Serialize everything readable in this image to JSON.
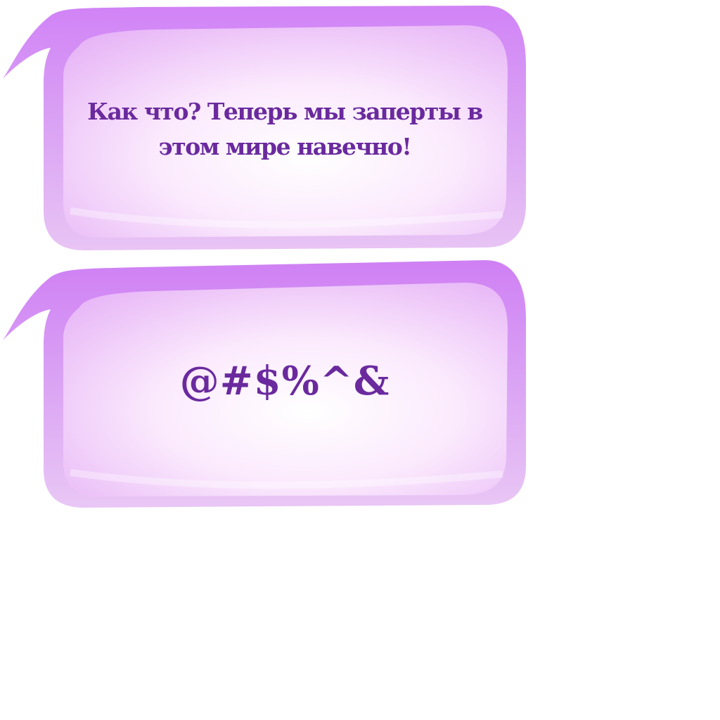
{
  "colors": {
    "bubble_edge": "#c77bf0",
    "bubble_inner": "#fbe9fd",
    "text": "#6a2a9e",
    "background": "#ffffff"
  },
  "bubbles": [
    {
      "text_line_1": "Как что? Теперь мы заперты в",
      "text_line_2": "этом мире навечно!"
    },
    {
      "text": "@#$%^&"
    }
  ]
}
